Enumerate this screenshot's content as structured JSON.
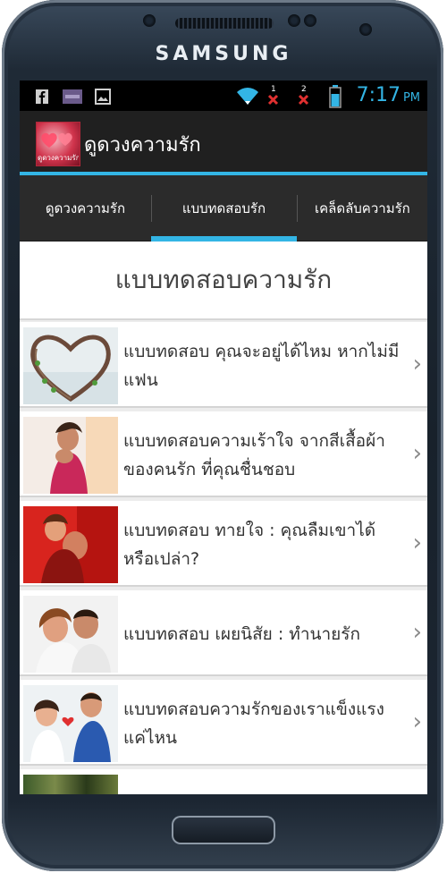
{
  "device": {
    "brand": "SAMSUNG"
  },
  "status_bar": {
    "time": "7:17",
    "ampm": "PM",
    "icons": [
      "facebook-icon",
      "app-notification-icon",
      "image-icon",
      "wifi-icon",
      "signal-1-icon",
      "signal-2-icon",
      "battery-icon"
    ],
    "sim1_label": "1",
    "sim2_label": "2"
  },
  "action_bar": {
    "title": "ดูดวงความรัก",
    "icon_caption": "ดูดวงความรัก"
  },
  "tabs": [
    {
      "label": "ดูดวงความรัก",
      "selected": false
    },
    {
      "label": "แบบทดสอบรัก",
      "selected": true
    },
    {
      "label": "เคล็ดลับความรัก",
      "selected": false
    }
  ],
  "section": {
    "title": "แบบทดสอบความรัก"
  },
  "list": [
    {
      "title": "แบบทดสอบ คุณจะอยู่ได้ไหม หากไม่มีแฟน"
    },
    {
      "title": "แบบทดสอบความเร้าใจ จากสีเสื้อผ้าของคนรัก ที่คุณชื่นชอบ"
    },
    {
      "title": "แบบทดสอบ ทายใจ : คุณลืมเขาได้หรือเปล่า?"
    },
    {
      "title": "แบบทดสอบ เผยนิสัย : ทำนายรัก"
    },
    {
      "title": "แบบทดสอบความรักของเราแข็งแรงแค่ไหน"
    }
  ],
  "colors": {
    "accent": "#33b5e5",
    "actionbar_bg": "#202020",
    "tabs_bg": "#2b2b2b",
    "list_bg": "#ffffff"
  }
}
